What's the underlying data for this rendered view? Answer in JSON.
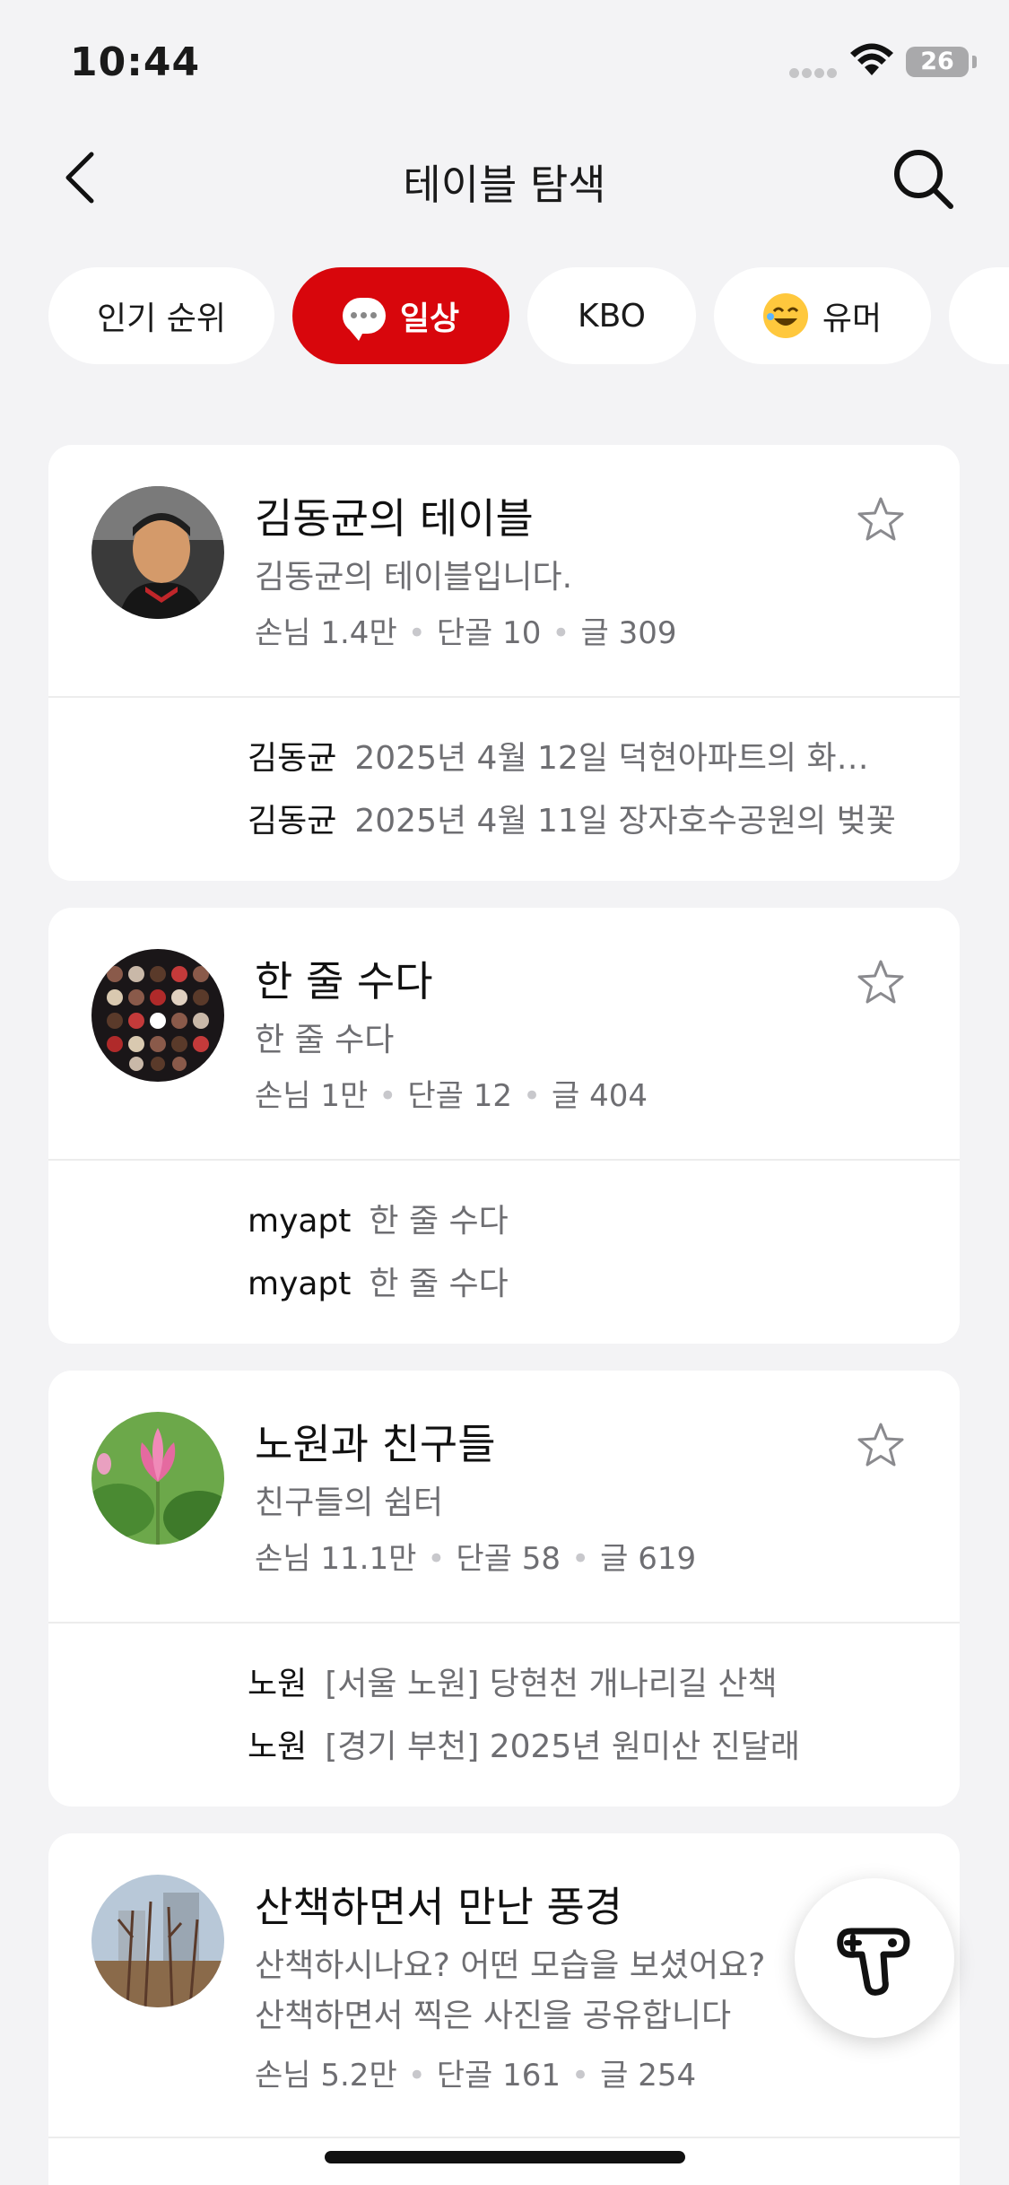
{
  "status": {
    "time": "10:44",
    "battery": "26"
  },
  "nav": {
    "title": "테이블 탐색"
  },
  "tabs": [
    {
      "label": "인기 순위",
      "active": false
    },
    {
      "label": "일상",
      "active": true,
      "icon": "speech-bubble-icon"
    },
    {
      "label": "KBO",
      "active": false
    },
    {
      "label": "유머",
      "active": false,
      "icon": "laughing-face-icon"
    }
  ],
  "cards": [
    {
      "title": "김동균의 테이블",
      "desc": "김동균의 테이블입니다.",
      "stats": {
        "guests": "손님 1.4만",
        "regulars": "단골 10",
        "posts": "글 309"
      },
      "recent": [
        {
          "author": "김동균",
          "text": "2025년 4월 12일 덕현아파트의 화…"
        },
        {
          "author": "김동균",
          "text": "2025년 4월 11일 장자호수공원의 벚꽃"
        }
      ]
    },
    {
      "title": "한 줄 수다",
      "desc": "한 줄 수다",
      "stats": {
        "guests": "손님 1만",
        "regulars": "단골 12",
        "posts": "글 404"
      },
      "recent": [
        {
          "author": "myapt",
          "text": "한 줄 수다"
        },
        {
          "author": "myapt",
          "text": "한 줄 수다"
        }
      ]
    },
    {
      "title": "노원과 친구들",
      "desc": "친구들의 쉼터",
      "stats": {
        "guests": "손님 11.1만",
        "regulars": "단골 58",
        "posts": "글 619"
      },
      "recent": [
        {
          "author": "노원",
          "text": "[서울 노원] 당현천 개나리길 산책"
        },
        {
          "author": "노원",
          "text": "[경기 부천] 2025년 원미산 진달래"
        }
      ]
    },
    {
      "title": "산책하면서 만난 풍경",
      "desc": "산책하시나요? 어떤 모습을 보셨어요?",
      "desc2": "산책하면서 찍은 사진을 공유합니다",
      "stats": {
        "guests": "손님 5.2만",
        "regulars": "단골 161",
        "posts": "글 254"
      }
    }
  ],
  "colors": {
    "accent": "#d8060c",
    "background": "#f3f3f5",
    "muted_text": "#6e6e72"
  }
}
